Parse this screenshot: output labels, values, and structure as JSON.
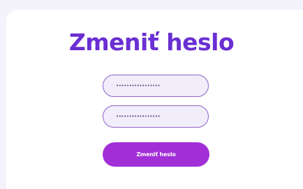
{
  "form": {
    "title": "Zmeniť heslo",
    "password_field_1_value": "•••••••••••••••••",
    "password_field_2_value": "•••••••••••••••••",
    "submit_label": "Zmeniť heslo"
  },
  "colors": {
    "accent_title": "#6a2fd2",
    "button": "#a12ed6",
    "field_border": "#8e63c9",
    "field_bg": "#f1edfb",
    "page_bg": "#f4f2fb"
  }
}
